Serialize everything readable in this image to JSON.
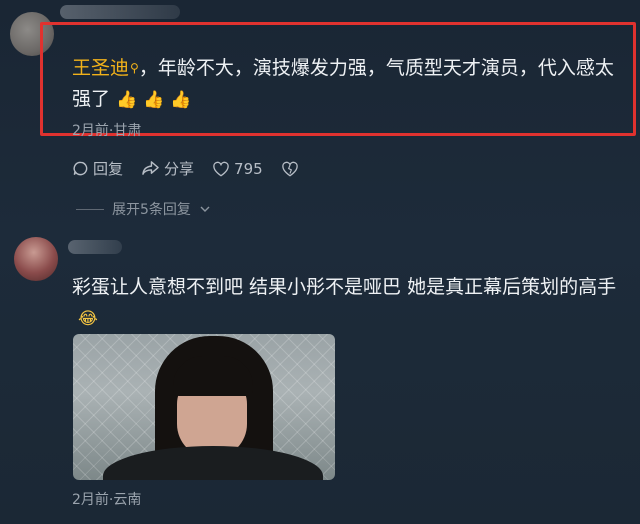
{
  "comment1": {
    "mention": "王圣迪",
    "text": "，年龄不大，演技爆发力强，气质型天才演员，代入感太强了",
    "emojis": [
      "👍",
      "👍",
      "👍"
    ],
    "meta": "2月前·甘肃"
  },
  "actions": {
    "reply": "回复",
    "share": "分享",
    "like_count": "795"
  },
  "expand_replies": "展开5条回复",
  "comment2": {
    "text": "彩蛋让人意想不到吧 结果小彤不是哑巴 她是真正幕后策划的高手",
    "emoji": "😂",
    "meta": "2月前·云南"
  },
  "colors": {
    "highlight_border": "#e0322f",
    "mention": "#f2b21a",
    "background": "#1a2634"
  }
}
